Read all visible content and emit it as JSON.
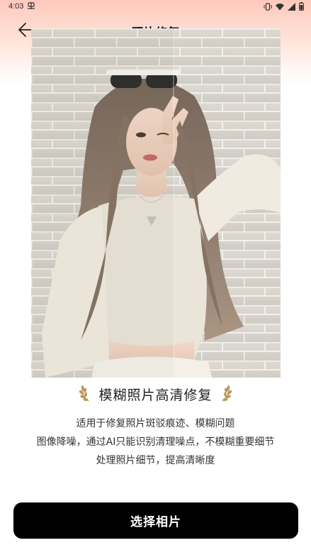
{
  "status_bar": {
    "time": "4:03",
    "icons": [
      "app-notification-icon",
      "vibrate-icon",
      "wifi-icon",
      "signal-icon",
      "battery-icon"
    ]
  },
  "header": {
    "title": "照片修复",
    "back_icon": "arrow-left-icon"
  },
  "feature": {
    "title": "模糊照片高清修复",
    "description_lines": [
      "适用于修复照片斑驳痕迹、模糊问题",
      "图像降噪，通过AI只能识别清理噪点，不模糊重要细节",
      "处理照片细节，提高清晰度"
    ]
  },
  "actions": {
    "select_photo_label": "选择相片"
  },
  "colors": {
    "header_gradient_top": "#ffc9bd",
    "button_bg": "#000000",
    "button_text": "#ffffff",
    "laurel_gold": "#b89a5e"
  }
}
